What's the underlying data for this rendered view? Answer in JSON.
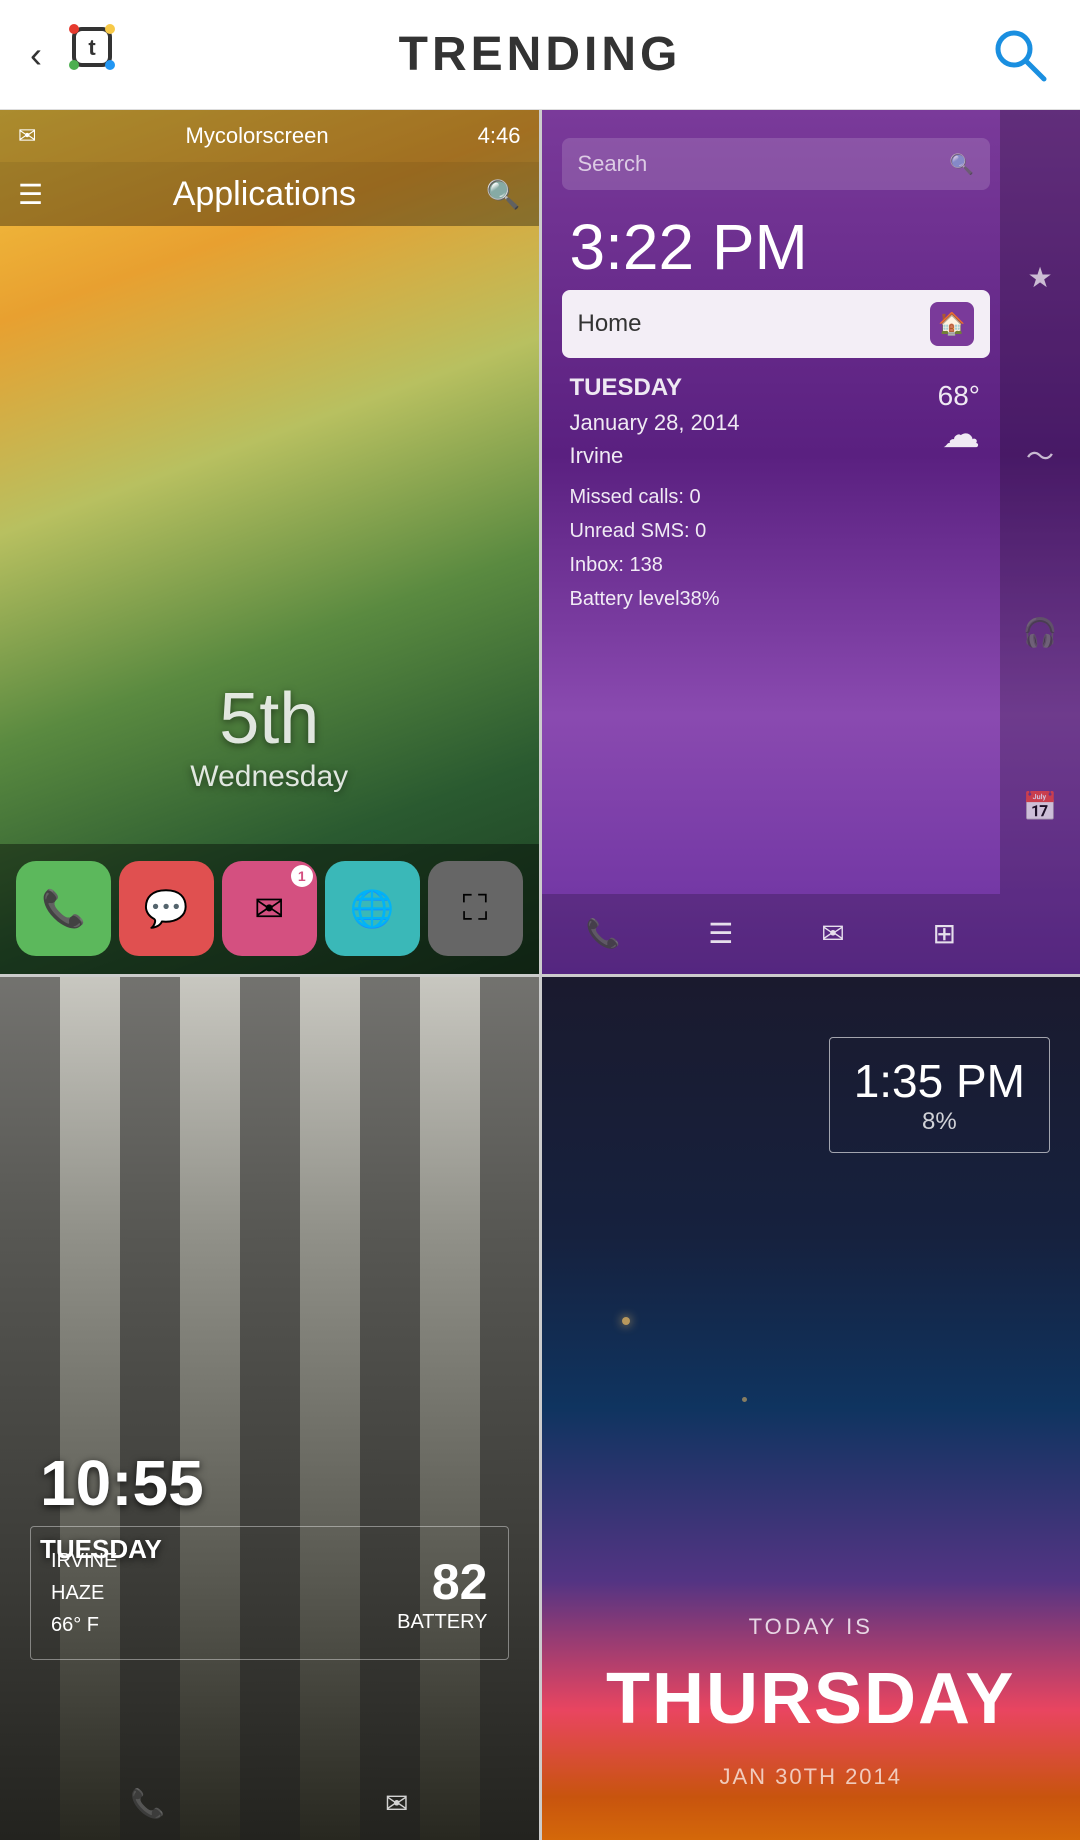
{
  "header": {
    "title": "TRENDING",
    "back_label": "‹",
    "search_label": "🔍"
  },
  "cell1": {
    "status_time": "4:46",
    "status_app": "Mycolorscreen",
    "app_title": "Applications",
    "date_num": "5th",
    "date_day": "Wednesday",
    "icons": [
      "📞",
      "💬",
      "✉",
      "🌐",
      "⛶"
    ]
  },
  "cell2": {
    "search_placeholder": "Search",
    "time": "3:22 PM",
    "home_label": "Home",
    "weather_day": "TUESDAY",
    "weather_date": "January 28, 2014",
    "weather_city": "Irvine",
    "weather_temp": "68°",
    "missed_calls": "Missed calls: 0",
    "unread_sms": "Unread SMS: 0",
    "inbox": "Inbox: 138",
    "battery": "Battery level38%"
  },
  "cell3": {
    "time": "10:55",
    "day": "TUESDAY",
    "city": "IRVINE",
    "condition": "HAZE",
    "temp": "66°  F",
    "battery_num": "82",
    "battery_label": "BATTERY",
    "bottom_icons": [
      "PHONE",
      "EMAIL"
    ]
  },
  "cell4": {
    "time": "1:35 PM",
    "battery_pct": "8%",
    "today_label": "TODAY IS",
    "day": "THURSDAY",
    "date": "JAN 30TH 2014"
  }
}
